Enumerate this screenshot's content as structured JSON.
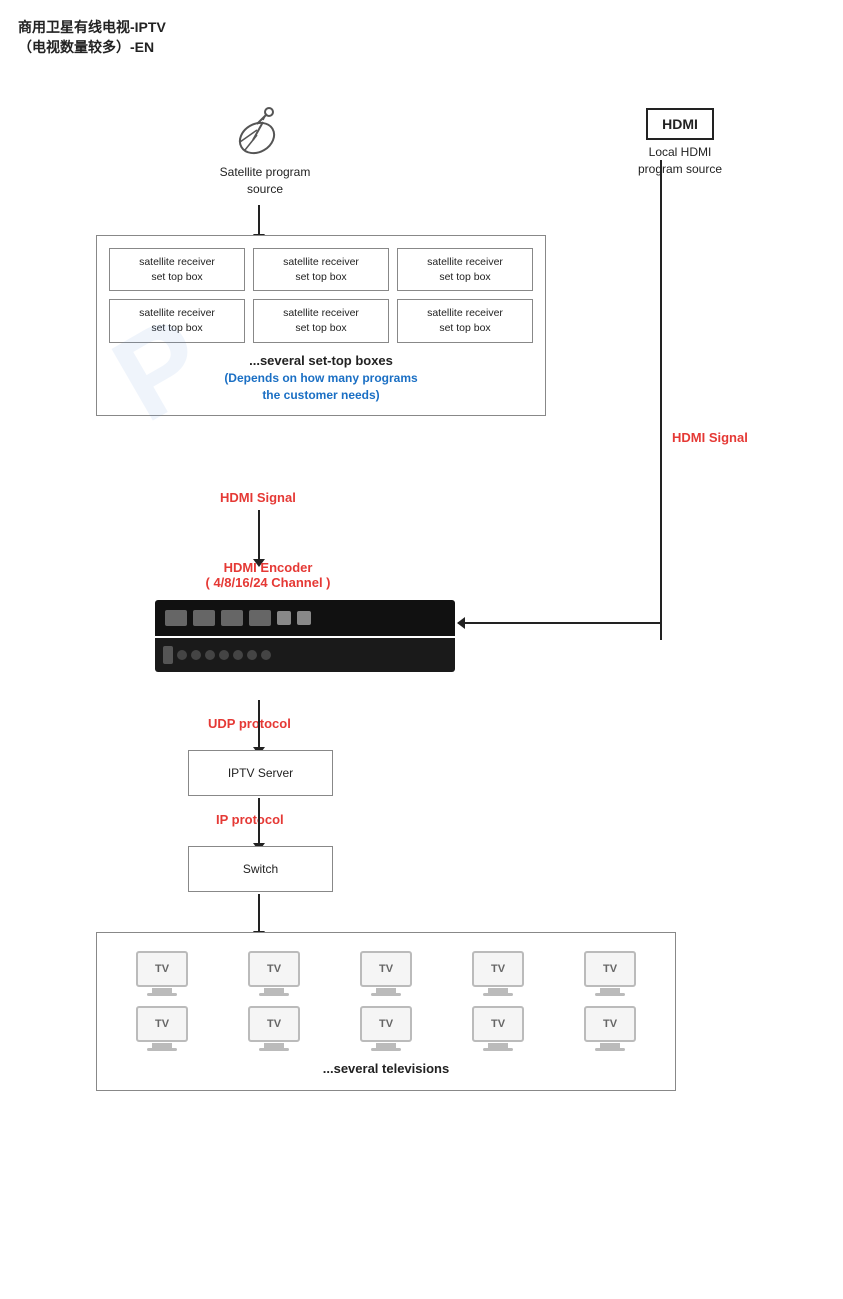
{
  "title": {
    "line1": "商用卫星有线电视-IPTV",
    "line2": "（电视数量较多）-EN"
  },
  "satellite": {
    "label": "Satellite program\nsource"
  },
  "hdmi_source": {
    "box_label": "HDMI",
    "label": "Local HDMI\nprogram source"
  },
  "stb": {
    "boxes": [
      "satellite receiver\nset top box",
      "satellite receiver\nset top box",
      "satellite receiver\nset top box",
      "satellite receiver\nset top box",
      "satellite receiver\nset top box",
      "satellite receiver\nset top box"
    ],
    "note": "...several set-top boxes",
    "sub": "(Depends on how many programs\nthe customer needs)"
  },
  "hdmi_signal_left": "HDMI Signal",
  "hdmi_signal_right": "HDMI Signal",
  "encoder": {
    "label": "HDMI Encoder",
    "sublabel": "( 4/8/16/24 Channel )"
  },
  "udp_label": "UDP protocol",
  "iptv_server": "IPTV Server",
  "ip_label": "IP protocol",
  "switch_label": "Switch",
  "tv": {
    "label": "TV",
    "note": "...several televisions"
  }
}
